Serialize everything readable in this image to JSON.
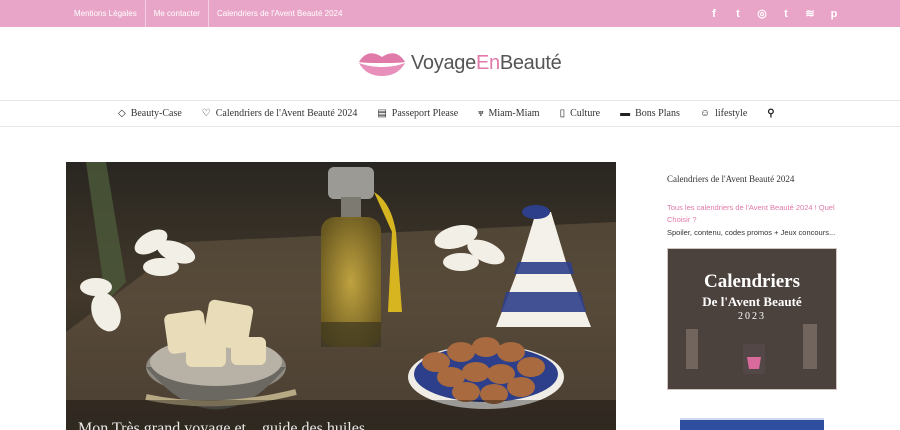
{
  "topbar": {
    "links": [
      "Mentions Légales",
      "Me contacter",
      "Calendriers de l'Avent Beauté 2024"
    ],
    "social_icons": [
      "facebook-icon",
      "twitter-icon",
      "instagram-icon",
      "tumblr-icon",
      "rss-icon",
      "pinterest-icon"
    ],
    "social_glyphs": [
      "f",
      "t",
      "◎",
      "t",
      "≋",
      "p"
    ],
    "color": "#e9a5c7"
  },
  "logo": {
    "part1": "Voyage",
    "part2": "En",
    "part3": "Beauté"
  },
  "nav": {
    "items": [
      {
        "icon": "diamond-icon",
        "glyph": "◇",
        "label": "Beauty-Case"
      },
      {
        "icon": "heart-icon",
        "glyph": "♡",
        "label": "Calendriers de l'Avent Beauté 2024"
      },
      {
        "icon": "passport-icon",
        "glyph": "▤",
        "label": "Passeport Please"
      },
      {
        "icon": "cutlery-icon",
        "glyph": "ᴪ",
        "label": "Miam-Miam"
      },
      {
        "icon": "bookmark-icon",
        "glyph": "▯",
        "label": "Culture"
      },
      {
        "icon": "ticket-icon",
        "glyph": "▬",
        "label": "Bons Plans"
      },
      {
        "icon": "smiley-icon",
        "glyph": "☺",
        "label": "lifestyle"
      }
    ],
    "search_glyph": "⚲"
  },
  "hero": {
    "title": "Mon Très grand voyage et... guide des huiles..."
  },
  "sidebar": {
    "heading": "Calendriers de l'Avent Beauté 2024",
    "link": "Tous les calendriers de l'Avent Beauté 2024 ! Quel Choisir ?",
    "desc": "Spoiler, contenu, codes promos + Jeux concours...",
    "promo": {
      "line1": "Calendriers",
      "line2": "De l'Avent Beauté",
      "year": "2023"
    }
  },
  "accent": "#e07aa8"
}
